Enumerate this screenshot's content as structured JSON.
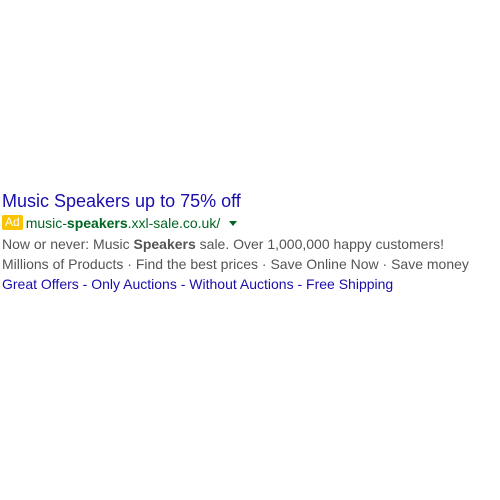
{
  "ad": {
    "title": "Music Speakers up to 75% off",
    "badge": "Ad",
    "url_prefix": "music-",
    "url_bold": "speakers",
    "url_suffix": ".xxl-sale.co.uk/",
    "description": {
      "before": "Now or never: Music ",
      "bold": "Speakers",
      "after": " sale. Over 1,000,000 happy customers!"
    },
    "callouts": [
      "Millions of Products",
      "Find the best prices",
      "Save Online Now",
      "Save money"
    ],
    "callout_separator": " · ",
    "sitelinks": [
      "Great Offers",
      "Only Auctions",
      "Without Auctions",
      "Free Shipping"
    ],
    "sitelink_separator": " - "
  },
  "colors": {
    "title": "#1a0dab",
    "url": "#006621",
    "badge_bg": "#fac402",
    "text": "#545454"
  },
  "icons": {
    "url_menu": "dropdown-arrow-icon"
  }
}
